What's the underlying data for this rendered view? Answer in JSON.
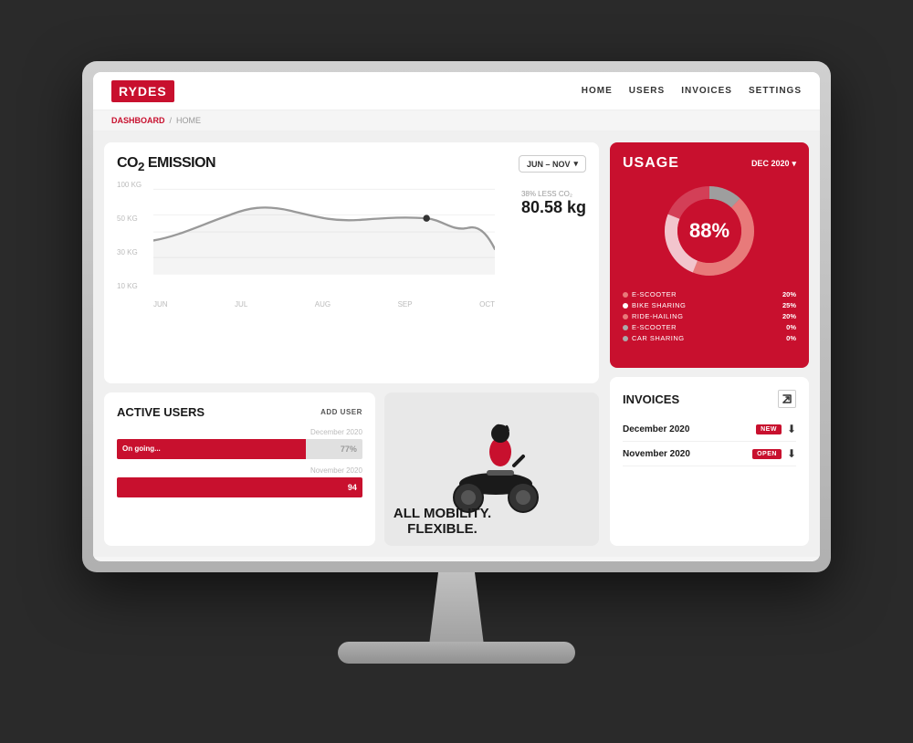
{
  "app": {
    "logo": "RYDES"
  },
  "nav": {
    "links": [
      "HOME",
      "USERS",
      "INVOICES",
      "SETTINGS"
    ]
  },
  "breadcrumb": {
    "active": "DASHBOARD",
    "separator": "/",
    "passive": "HOME"
  },
  "co2": {
    "title": "CO",
    "sub": "2",
    "suffix": " EMISSION",
    "date_range": "JUN – NOV",
    "y_labels": [
      "100 KG",
      "50 KG",
      "30 KG",
      "10 KG"
    ],
    "x_labels": [
      "JUN",
      "JUL",
      "AUG",
      "SEP",
      "OCT"
    ],
    "highlight_pct": "38% LESS CO₂",
    "highlight_val": "80.58 kg"
  },
  "active_users": {
    "title": "ACTIVE USERS",
    "add_button": "ADD USER",
    "bars": [
      {
        "label": "On going...",
        "pct": 77,
        "value": "77%",
        "date": "December 2020",
        "show_pct": true
      },
      {
        "label": "",
        "pct": 100,
        "value": "94",
        "date": "November 2020",
        "show_pct": false
      }
    ]
  },
  "scooter": {
    "line1": "ALL MOBILITY.",
    "line2": "FLEXIBLE."
  },
  "usage": {
    "title": "USAGE",
    "date": "DEC 2020",
    "percentage": "88%",
    "legend": [
      {
        "name": "E-SCOOTER",
        "pct": "20%",
        "color": "#e87a7a"
      },
      {
        "name": "BIKE SHARING",
        "pct": "25%",
        "color": "#fff"
      },
      {
        "name": "RIDE-HAILING",
        "pct": "20%",
        "color": "#e87a7a"
      },
      {
        "name": "E-SCOOTER",
        "pct": "0%",
        "color": "#aaa"
      },
      {
        "name": "CAR SHARING",
        "pct": "0%",
        "color": "#aaa"
      }
    ]
  },
  "invoices": {
    "title": "INVOICES",
    "rows": [
      {
        "month": "December 2020",
        "badge": "NEW",
        "badge_type": "new"
      },
      {
        "month": "November 2020",
        "badge": "OPEN",
        "badge_type": "open"
      }
    ]
  }
}
